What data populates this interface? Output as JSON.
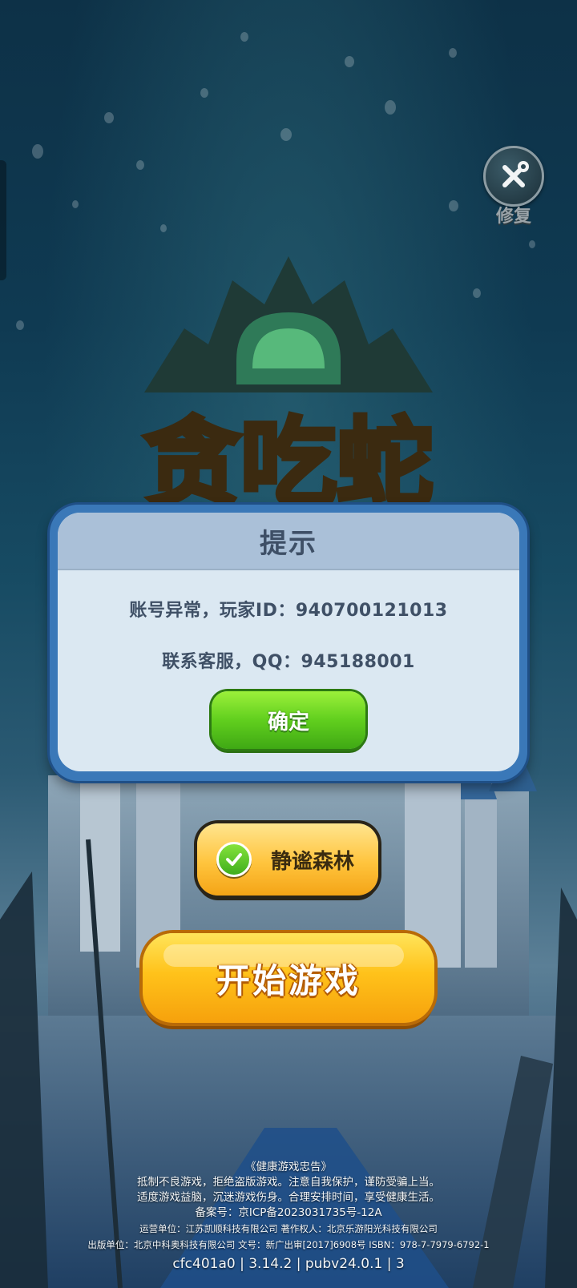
{
  "repair": {
    "label": "修复",
    "icon": "wrench-screwdriver-icon"
  },
  "logo": {
    "title": "贪吃蛇"
  },
  "dialog": {
    "title": "提示",
    "line1": "账号异常，玩家ID：940700121013",
    "line2": "联系客服，QQ：945188001",
    "confirm_label": "确定"
  },
  "region": {
    "label": "静谧森林",
    "selected_icon": "check-icon"
  },
  "start": {
    "label": "开始游戏"
  },
  "footer": {
    "line1": "《健康游戏忠告》",
    "line2": "抵制不良游戏，拒绝盗版游戏。注意自我保护，谨防受骗上当。",
    "line3": "适度游戏益脑，沉迷游戏伤身。合理安排时间，享受健康生活。",
    "line4": "备案号：京ICP备2023031735号-12A",
    "line5": "运营单位：江苏凯顺科技有限公司 著作权人：北京乐游阳光科技有限公司",
    "line6": "出版单位：北京中科奥科技有限公司 文号：新广出审[2017]6908号 ISBN：978-7-7979-6792-1",
    "version": "cfc401a0 | 3.14.2 | pubv24.0.1 | 3"
  },
  "colors": {
    "dialog_border": "#3a78b8",
    "dialog_body": "#dbe8f2",
    "confirm_green": "#61cf1e",
    "start_yellow": "#ffc21a"
  }
}
